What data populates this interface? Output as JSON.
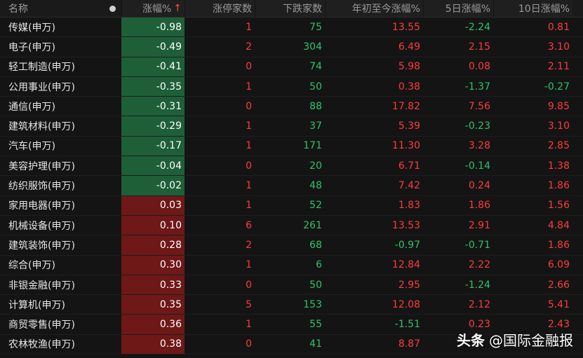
{
  "header": {
    "name": "名称",
    "change": "涨幅%",
    "change_sort": "↑",
    "limit_up": "涨停家数",
    "down_count": "下跌家数",
    "ytd": "年初至今涨幅%",
    "d5": "5日涨幅%",
    "d10": "10日涨幅%"
  },
  "rows": [
    {
      "name": "传媒(申万)",
      "chg": "-0.98",
      "up": "1",
      "down": "75",
      "ytd": "13.55",
      "d5": "-2.24",
      "d10": "0.81"
    },
    {
      "name": "电子(申万)",
      "chg": "-0.49",
      "up": "2",
      "down": "304",
      "ytd": "6.49",
      "d5": "2.15",
      "d10": "3.10"
    },
    {
      "name": "轻工制造(申万)",
      "chg": "-0.41",
      "up": "0",
      "down": "74",
      "ytd": "5.98",
      "d5": "0.08",
      "d10": "2.11"
    },
    {
      "name": "公用事业(申万)",
      "chg": "-0.35",
      "up": "1",
      "down": "50",
      "ytd": "0.38",
      "d5": "-1.37",
      "d10": "-0.27"
    },
    {
      "name": "通信(申万)",
      "chg": "-0.31",
      "up": "0",
      "down": "88",
      "ytd": "17.82",
      "d5": "7.56",
      "d10": "9.85"
    },
    {
      "name": "建筑材料(申万)",
      "chg": "-0.29",
      "up": "1",
      "down": "37",
      "ytd": "5.39",
      "d5": "-0.23",
      "d10": "3.10"
    },
    {
      "name": "汽车(申万)",
      "chg": "-0.17",
      "up": "1",
      "down": "171",
      "ytd": "11.30",
      "d5": "3.28",
      "d10": "2.85"
    },
    {
      "name": "美容护理(申万)",
      "chg": "-0.04",
      "up": "0",
      "down": "20",
      "ytd": "6.71",
      "d5": "-0.14",
      "d10": "1.38"
    },
    {
      "name": "纺织服饰(申万)",
      "chg": "-0.02",
      "up": "1",
      "down": "48",
      "ytd": "7.42",
      "d5": "0.24",
      "d10": "1.86"
    },
    {
      "name": "家用电器(申万)",
      "chg": "0.03",
      "up": "1",
      "down": "52",
      "ytd": "1.83",
      "d5": "1.86",
      "d10": "1.56"
    },
    {
      "name": "机械设备(申万)",
      "chg": "0.10",
      "up": "6",
      "down": "261",
      "ytd": "13.53",
      "d5": "2.91",
      "d10": "4.84"
    },
    {
      "name": "建筑装饰(申万)",
      "chg": "0.28",
      "up": "2",
      "down": "68",
      "ytd": "-0.97",
      "d5": "-0.71",
      "d10": "1.86"
    },
    {
      "name": "综合(申万)",
      "chg": "0.30",
      "up": "1",
      "down": "6",
      "ytd": "12.84",
      "d5": "2.22",
      "d10": "6.09"
    },
    {
      "name": "非银金融(申万)",
      "chg": "0.33",
      "up": "0",
      "down": "50",
      "ytd": "2.95",
      "d5": "-1.24",
      "d10": "2.66"
    },
    {
      "name": "计算机(申万)",
      "chg": "0.35",
      "up": "5",
      "down": "153",
      "ytd": "12.08",
      "d5": "2.12",
      "d10": "5.41"
    },
    {
      "name": "商贸零售(申万)",
      "chg": "0.36",
      "up": "1",
      "down": "55",
      "ytd": "-1.51",
      "d5": "0.23",
      "d10": "2.43"
    },
    {
      "name": "农林牧渔(申万)",
      "chg": "0.38",
      "up": "0",
      "down": "41",
      "ytd": "8.87",
      "d5": "",
      "d10": ""
    }
  ],
  "watermark": {
    "brand": "头条",
    "handle": "@国际金融报"
  },
  "colors": {
    "up": "#ff3b3b",
    "down": "#2ec36a",
    "neg_bg": "#1e5f38",
    "pos_bg": "#6e1818"
  }
}
